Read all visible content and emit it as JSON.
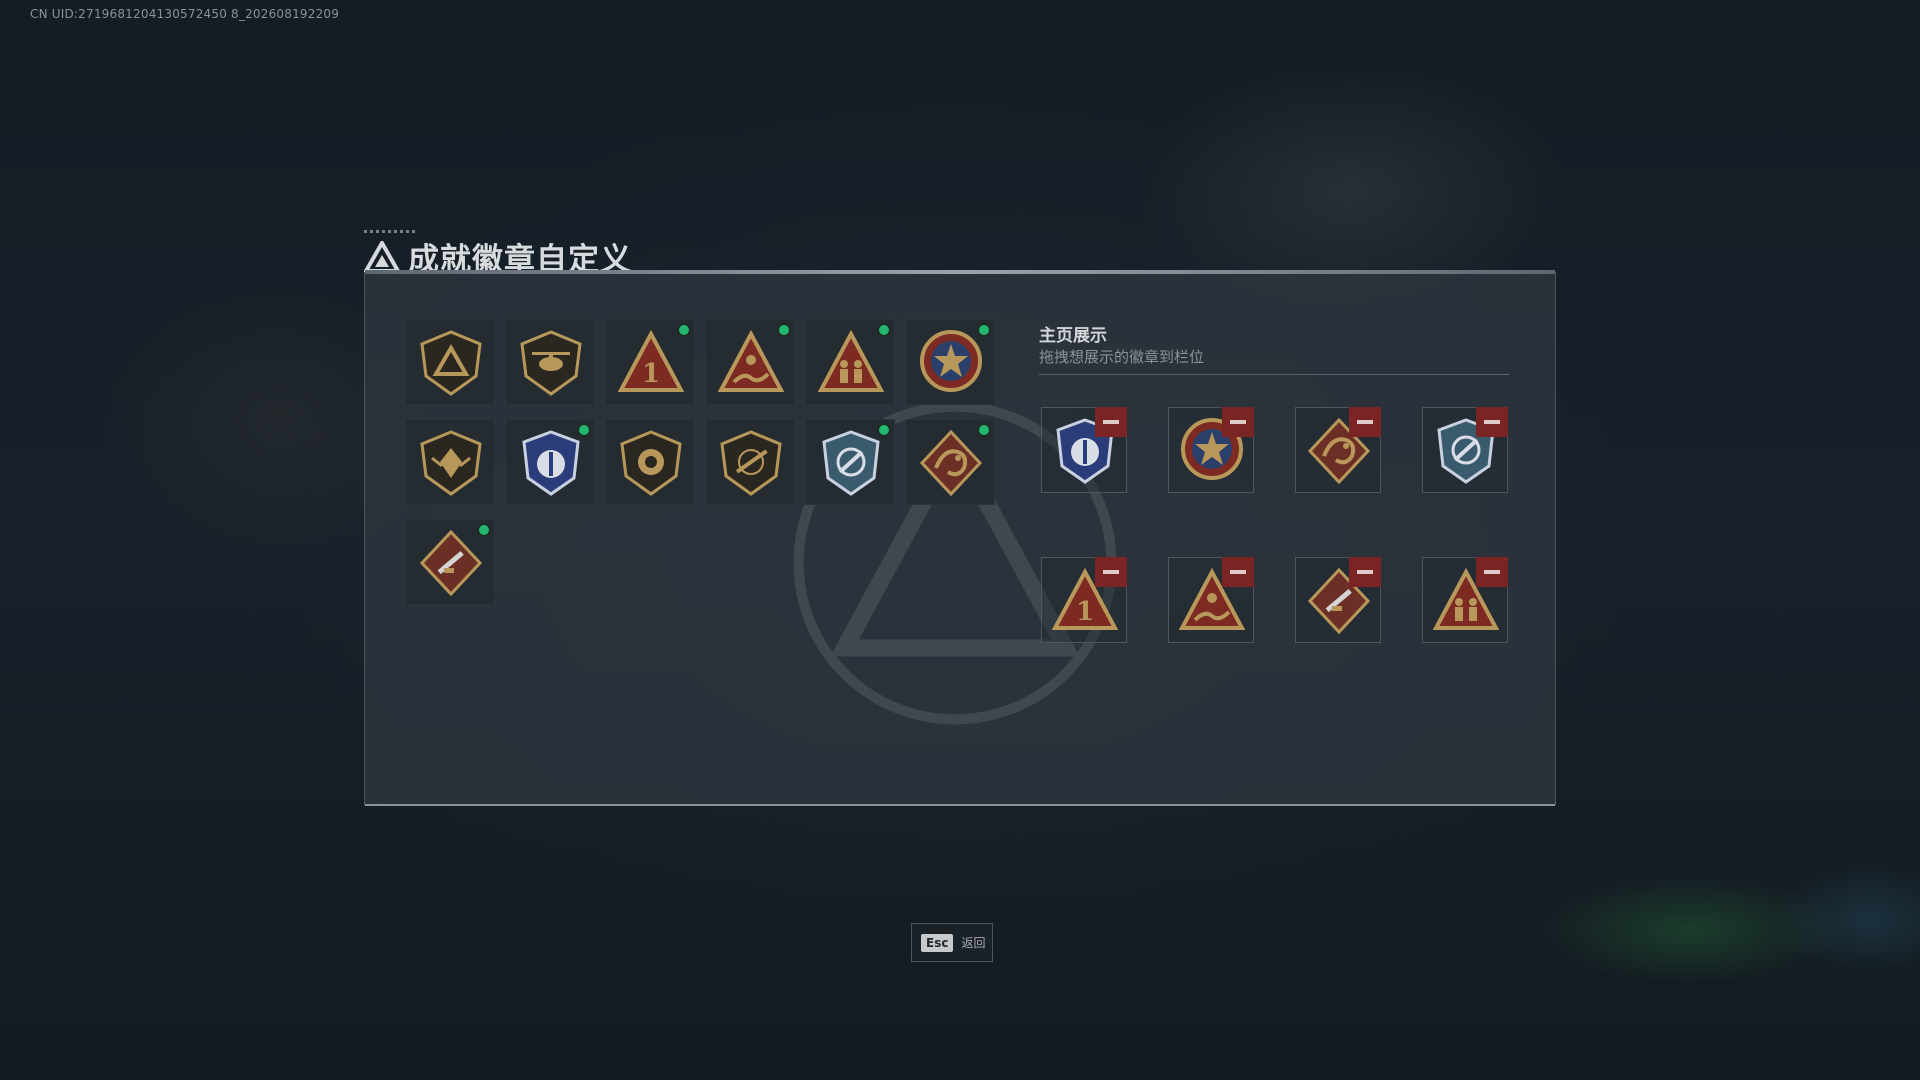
{
  "uid_text": "CN UID:2719681204130572450 8_202608192209",
  "title": "成就徽章自定义",
  "display": {
    "title": "主页展示",
    "subtitle": "拖拽想展示的徽章到栏位"
  },
  "footer": {
    "key": "Esc",
    "label": "返回"
  },
  "colors": {
    "new_dot": "#22b86d",
    "remove": "#7a2424",
    "gold": "#b8985a"
  },
  "inventory": [
    {
      "icon": "delta-shield-icon",
      "new": false
    },
    {
      "icon": "helicopter-shield-icon",
      "new": false
    },
    {
      "icon": "number-one-triangle-icon",
      "new": true
    },
    {
      "icon": "wave-rider-triangle-icon",
      "new": true
    },
    {
      "icon": "squad-triangle-icon",
      "new": true
    },
    {
      "icon": "star-medal-icon",
      "new": true
    },
    {
      "icon": "wing-shield-icon",
      "new": false
    },
    {
      "icon": "blue-police-crest-icon",
      "new": true
    },
    {
      "icon": "lion-shield-icon",
      "new": false
    },
    {
      "icon": "rifle-shield-icon",
      "new": false
    },
    {
      "icon": "blue-anchor-crest-icon",
      "new": true
    },
    {
      "icon": "dragon-diamond-icon",
      "new": true
    },
    {
      "icon": "blade-diamond-icon",
      "new": true
    }
  ],
  "displayed": [
    {
      "icon": "blue-police-crest-icon"
    },
    {
      "icon": "star-medal-icon"
    },
    {
      "icon": "dragon-diamond-icon"
    },
    {
      "icon": "blue-anchor-crest-icon"
    },
    {
      "icon": "number-one-triangle-icon"
    },
    {
      "icon": "wave-rider-triangle-icon"
    },
    {
      "icon": "blade-diamond-icon"
    },
    {
      "icon": "squad-triangle-icon"
    }
  ]
}
